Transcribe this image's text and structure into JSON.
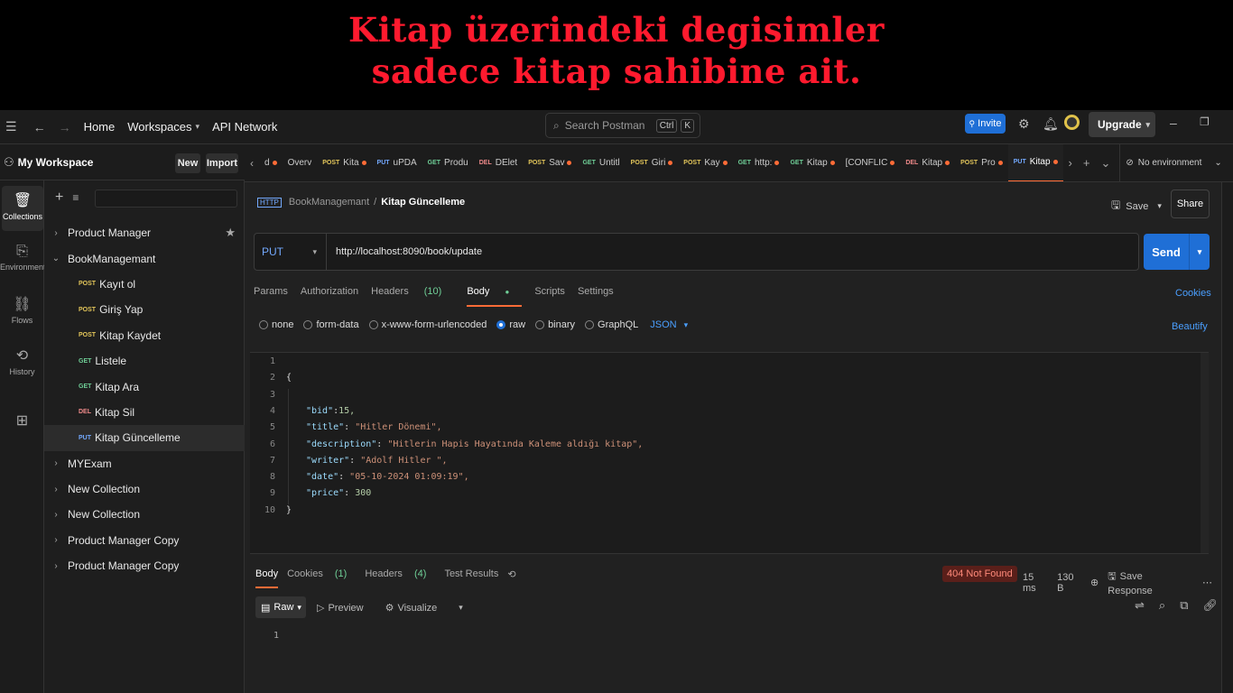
{
  "banner": {
    "line1": "Kitap üzerindeki degisimler",
    "line2": "sadece kitap sahibine ait."
  },
  "topbar": {
    "home": "Home",
    "workspaces": "Workspaces",
    "api_network": "API Network",
    "search_placeholder": "Search Postman",
    "shortcut_ctrl": "Ctrl",
    "shortcut_k": "K",
    "invite": "Invite",
    "upgrade": "Upgrade"
  },
  "rail": {
    "collections": "Collections",
    "environments": "Environments",
    "flows": "Flows",
    "history": "History"
  },
  "sidebar": {
    "workspace_title": "My Workspace",
    "new_label": "New",
    "import_label": "Import",
    "tree": [
      {
        "type": "collection",
        "label": "Product Manager",
        "expanded": false,
        "starred": true
      },
      {
        "type": "collection",
        "label": "BookManagemant",
        "expanded": true
      },
      {
        "type": "request",
        "method": "POST",
        "label": "Kayıt ol"
      },
      {
        "type": "request",
        "method": "POST",
        "label": "Giriş Yap"
      },
      {
        "type": "request",
        "method": "POST",
        "label": "Kitap Kaydet"
      },
      {
        "type": "request",
        "method": "GET",
        "label": "Listele"
      },
      {
        "type": "request",
        "method": "GET",
        "label": "Kitap Ara"
      },
      {
        "type": "request",
        "method": "DEL",
        "label": "Kitap Sil"
      },
      {
        "type": "request",
        "method": "PUT",
        "label": "Kitap Güncelleme",
        "selected": true
      },
      {
        "type": "collection",
        "label": "MYExam",
        "expanded": false
      },
      {
        "type": "collection",
        "label": "New Collection",
        "expanded": false
      },
      {
        "type": "collection",
        "label": "New Collection",
        "expanded": false
      },
      {
        "type": "collection",
        "label": "Product Manager Copy",
        "expanded": false
      },
      {
        "type": "collection",
        "label": "Product Manager Copy",
        "expanded": false
      }
    ]
  },
  "tabs": [
    {
      "method": "",
      "label": "d",
      "dot": true
    },
    {
      "method": "",
      "label": "Overv",
      "dot": false
    },
    {
      "method": "POST",
      "label": "Kita",
      "dot": true
    },
    {
      "method": "PUT",
      "label": "uPDA",
      "dot": false
    },
    {
      "method": "GET",
      "label": "Produ",
      "dot": false
    },
    {
      "method": "DEL",
      "label": "DElet",
      "dot": false
    },
    {
      "method": "POST",
      "label": "Sav",
      "dot": true
    },
    {
      "method": "GET",
      "label": "Untitl",
      "dot": false
    },
    {
      "method": "POST",
      "label": "Giri",
      "dot": true
    },
    {
      "method": "POST",
      "label": "Kay",
      "dot": true
    },
    {
      "method": "GET",
      "label": "http:",
      "dot": true
    },
    {
      "method": "GET",
      "label": "Kitap",
      "dot": true
    },
    {
      "method": "",
      "label": "[CONFLIC",
      "dot": true
    },
    {
      "method": "DEL",
      "label": "Kitap",
      "dot": true
    },
    {
      "method": "POST",
      "label": "Pro",
      "dot": true
    },
    {
      "method": "PUT",
      "label": "Kitap",
      "dot": true,
      "active": true
    }
  ],
  "env": {
    "label": "No environment"
  },
  "request": {
    "breadcrumb_collection": "BookManagemant",
    "breadcrumb_sep": "/",
    "breadcrumb_current": "Kitap Güncelleme",
    "save": "Save",
    "share": "Share",
    "method": "PUT",
    "url": "http://localhost:8090/book/update",
    "send": "Send",
    "tabs": {
      "params": "Params",
      "authorization": "Authorization",
      "headers": "Headers",
      "headers_count": "(10)",
      "body": "Body",
      "scripts": "Scripts",
      "settings": "Settings"
    },
    "cookies": "Cookies",
    "body_types": {
      "none": "none",
      "form_data": "form-data",
      "urlencoded": "x-www-form-urlencoded",
      "raw": "raw",
      "binary": "binary",
      "graphql": "GraphQL",
      "json": "JSON"
    },
    "beautify": "Beautify",
    "code_lines": [
      "",
      "{",
      "",
      "\"bid\":15,",
      "\"title\": \"Hitler Dönemi\",",
      "\"description\": \"Hitlerin Hapis Hayatında Kaleme aldığı kitap\",",
      "\"writer\": \"Adolf Hitler \",",
      "\"date\": \"05-10-2024 01:09:19\",",
      "\"price\": 300",
      "}"
    ],
    "line_numbers": [
      "1",
      "2",
      "3",
      "4",
      "5",
      "6",
      "7",
      "8",
      "9",
      "10"
    ]
  },
  "response": {
    "tabs": {
      "body": "Body",
      "cookies": "Cookies",
      "cookies_count": "(1)",
      "headers": "Headers",
      "headers_count": "(4)",
      "test_results": "Test Results"
    },
    "status": "404 Not Found",
    "time": "15 ms",
    "size": "130 B",
    "save_response": "Save Response",
    "raw": "Raw",
    "preview": "Preview",
    "visualize": "Visualize",
    "line1": "1"
  }
}
